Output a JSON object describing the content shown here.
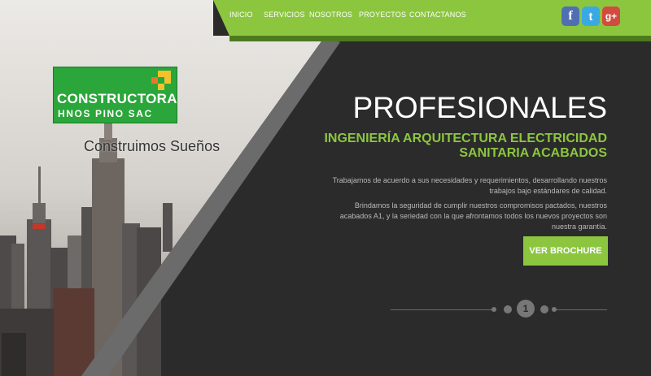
{
  "nav": {
    "items": [
      {
        "label": "INICIO"
      },
      {
        "label": "SERVICIOS"
      },
      {
        "label": "NOSOTROS"
      },
      {
        "label": "PROYECTOS"
      },
      {
        "label": "CONTACTANOS"
      }
    ]
  },
  "social": {
    "facebook": "f",
    "twitter": "t",
    "googleplus": "g+"
  },
  "logo": {
    "title": "CONSTRUCTORA",
    "subtitle": "HNOS PINO SAC"
  },
  "tagline": "Construimos Sueños",
  "hero": {
    "headline": "PROFESIONALES",
    "subhead": "INGENIERÍA ARQUITECTURA ELECTRICIDAD SANITARIA ACABADOS",
    "paragraph1": "Trabajamos de acuerdo a sus necesidades y requerimientos, desarrollando nuestros trabajos bajo estándares de calidad.",
    "paragraph2": "Brindamos la seguridad de cumplir nuestros compromisos pactados, nuestros acabados A1, y la seriedad con la que afrontamos todos los nuevos proyectos son nuestra garantía.",
    "cta_label": "VER BROCHURE"
  },
  "pager": {
    "current": "1"
  },
  "colors": {
    "accent_green": "#8cc63f",
    "dark_panel": "#2b2b2b",
    "stripe_gray": "#6b6b6b"
  }
}
